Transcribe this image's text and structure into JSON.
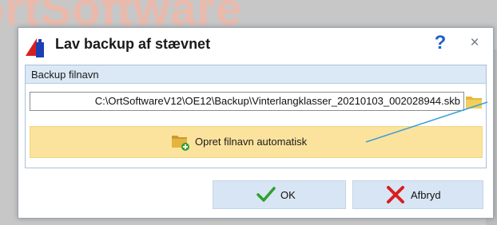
{
  "background": {
    "logo_text": "ortSoftware"
  },
  "dialog": {
    "title": "Lav backup af stævnet",
    "help_label": "?",
    "close_label": "×"
  },
  "backup": {
    "group_label": "Backup filnavn",
    "filename_value": "C:\\OrtSoftwareV12\\OE12\\Backup\\Vinterlangklasser_20210103_002028944.skb",
    "auto_button_label": "Opret filnavn automatisk"
  },
  "footer": {
    "ok_label": "OK",
    "cancel_label": "Afbryd"
  },
  "colors": {
    "accent_yellow": "#fce39d",
    "button_blue": "#d8e5f4",
    "header_blue": "#dbe8f5",
    "help_blue": "#1b63c6",
    "ok_green": "#2ea12e",
    "cancel_red": "#d81f1f",
    "pointer_line": "#3aa0d8"
  },
  "icons": {
    "app": "ortsoftware-logo-icon",
    "browse": "folder-icon",
    "auto": "folder-add-icon",
    "ok": "checkmark-icon",
    "cancel": "x-icon"
  }
}
